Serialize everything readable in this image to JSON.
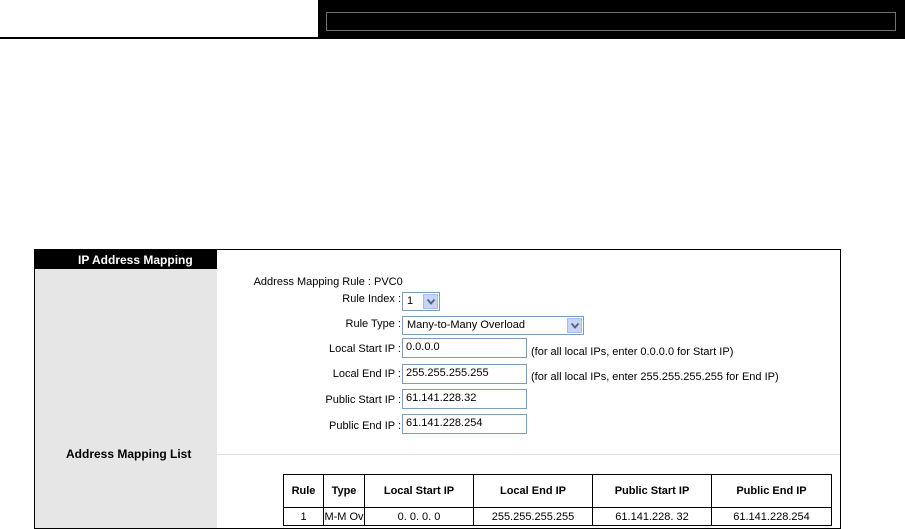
{
  "section_title": "IP Address Mapping",
  "list_title": "Address Mapping List",
  "form": {
    "rule_label": "Address Mapping Rule :",
    "rule_value": "PVC0",
    "index_label": "Rule Index :",
    "index_value": "1",
    "type_label": "Rule Type :",
    "type_value": "Many-to-Many Overload",
    "local_start_label": "Local Start IP :",
    "local_start_value": "0.0.0.0",
    "local_start_hint": "(for all local IPs, enter 0.0.0.0 for Start IP)",
    "local_end_label": "Local End IP :",
    "local_end_value": "255.255.255.255",
    "local_end_hint": "(for all local IPs, enter 255.255.255.255 for End IP)",
    "public_start_label": "Public Start IP :",
    "public_start_value": "61.141.228.32",
    "public_end_label": "Public End IP :",
    "public_end_value": "61.141.228.254"
  },
  "table": {
    "headers": [
      "Rule",
      "Type",
      "Local Start IP",
      "Local End IP",
      "Public Start IP",
      "Public End IP"
    ],
    "rows": [
      [
        "1",
        "M-M Ov",
        "0. 0. 0. 0",
        "255.255.255.255",
        "61.141.228. 32",
        "61.141.228.254"
      ]
    ]
  },
  "colors": {
    "header_bg": "#000000",
    "sidebar_bg": "#e6e6e6",
    "dropdown_button": "#c6d5f6",
    "input_border": "#7f9db9"
  },
  "icons": {
    "dropdown": "chevron-down-icon"
  }
}
